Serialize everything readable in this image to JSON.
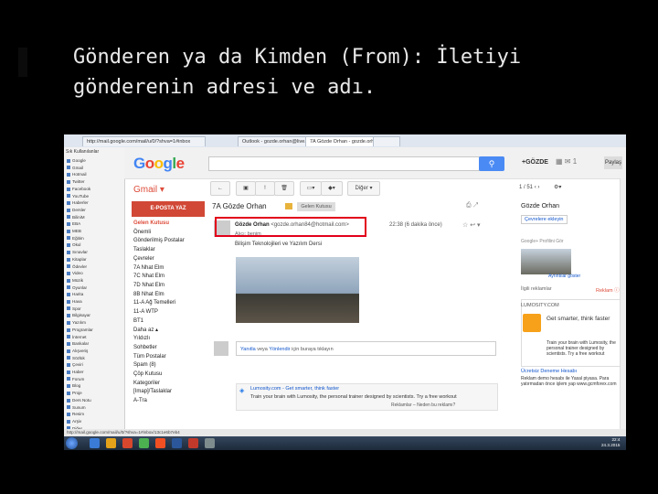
{
  "slide": {
    "title": "Gönderen ya da Kimden (From): İletiyi\ngönderenin adresi ve adı."
  },
  "browser": {
    "tabs": [
      "http://mail.google.com/mail/u/0/?shva=1#inbox",
      "Outlook - gozde.orhan@live...",
      "7A Gözde Orhan - gozde.orhan...",
      ""
    ],
    "favorites_header": "Sık Kullanılanlar",
    "favorites": [
      "Google",
      "Gmail",
      "Hotmail",
      "Twitter",
      "Facebook",
      "YouTube",
      "Haberler",
      "Dersler",
      "BiliniM",
      "EBA",
      "MEB",
      "Eğitim",
      "Okul",
      "Sınavlar",
      "Kitaplar",
      "Ödevler",
      "Video",
      "Müzik",
      "Oyunlar",
      "Harita",
      "Hava",
      "Spor",
      "Bilgisayar",
      "Yazılım",
      "Programlar",
      "İnternet",
      "Bankalar",
      "Alışveriş",
      "Sözlük",
      "Çeviri",
      "Haber",
      "Forum",
      "Blog",
      "Proje",
      "Ders Notu",
      "Sunum",
      "Resim",
      "Arşiv",
      "Diğer",
      "VODAFONE/NET"
    ],
    "status_text": "http://mail.google.com/mail/u/0/?shva=1#inbox/13c1e6b7eb4"
  },
  "gmail": {
    "logo": "Google",
    "user": "+GÖZDE",
    "share": "Paylaş",
    "app_label": "Gmail ▾",
    "compose_label": "E-POSTA YAZ",
    "toolbar_more": "Diğer ▾",
    "pager": "1 / 51",
    "nav": [
      {
        "label": "Gelen Kutusu",
        "active": true
      },
      {
        "label": "Önemli",
        "active": false
      },
      {
        "label": "Gönderilmiş Postalar",
        "active": false
      },
      {
        "label": "Taslaklar",
        "active": false
      },
      {
        "label": "Çevreler",
        "active": false
      },
      {
        "label": "7A Nhat Elm",
        "active": false
      },
      {
        "label": "7C Nhat Elm",
        "active": false
      },
      {
        "label": "7D Nhat Elm",
        "active": false
      },
      {
        "label": "8B Nhat Elm",
        "active": false
      },
      {
        "label": "11-A Ağ Temelleri",
        "active": false
      },
      {
        "label": "11-A WTP",
        "active": false
      },
      {
        "label": "BT1",
        "active": false
      },
      {
        "label": "Daha az ▴",
        "active": false
      },
      {
        "label": "Yıldızlı",
        "active": false
      },
      {
        "label": "Sohbetler",
        "active": false
      },
      {
        "label": "Tüm Postalar",
        "active": false
      },
      {
        "label": "Spam (8)",
        "active": false
      },
      {
        "label": "Çöp Kutusu",
        "active": false
      },
      {
        "label": "Kategoriler",
        "active": false
      },
      {
        "label": "[Imap]/Taslaklar",
        "active": false
      },
      {
        "label": "A-Tra",
        "active": false
      }
    ],
    "message": {
      "subject": "7A Gözde Orhan",
      "label_chip": "Gelen Kutusu",
      "sender_name": "Gözde Orhan",
      "sender_email": "<gozde.orhan84@hotmail.com>",
      "datetime": "22:38 (6 dakika önce)",
      "to_line": "Alıcı: benim",
      "body": "Bilişim Teknolojileri ve Yazılım Dersi",
      "reply_prompt_prefix": "Yanıtla",
      "reply_prompt_mid": "veya",
      "reply_prompt_link": "Yönlendir",
      "reply_prompt_suffix": "için buraya tıklayın",
      "ad_title": "Lumosity.com - Get smarter, think faster",
      "ad_text": "Train your brain with Lumosity, the personal trainer designed by scientists. Try a free workout",
      "ad_footer": "Reklamlar – Neden bu reklamı?"
    },
    "right_panel": {
      "name": "Gözde Orhan",
      "add_circle": "Çevrelere ekleyin",
      "profile_sub": "Google+ Profilini Gör",
      "photo_caption": "Ayrıntılar göster",
      "section_title": "İlgili reklamlar",
      "section_close": "Reklam ⓘ",
      "lumos_logo": "LUMOSITY.COM",
      "lumos_head": "Get smarter, think faster",
      "lumos_text": "Train your brain with Lumosity, the personal trainer designed by scientists. Try a free workout",
      "ad2_title": "Ücretsiz Deneme Hesabı",
      "ad2_text": "Reklam demo hesabı ile Yasal piyasa. Para yatırmadan önce işlem yap www.gcmforex.com"
    },
    "clock": {
      "time": "22:4",
      "date": "24.3.2015"
    }
  }
}
